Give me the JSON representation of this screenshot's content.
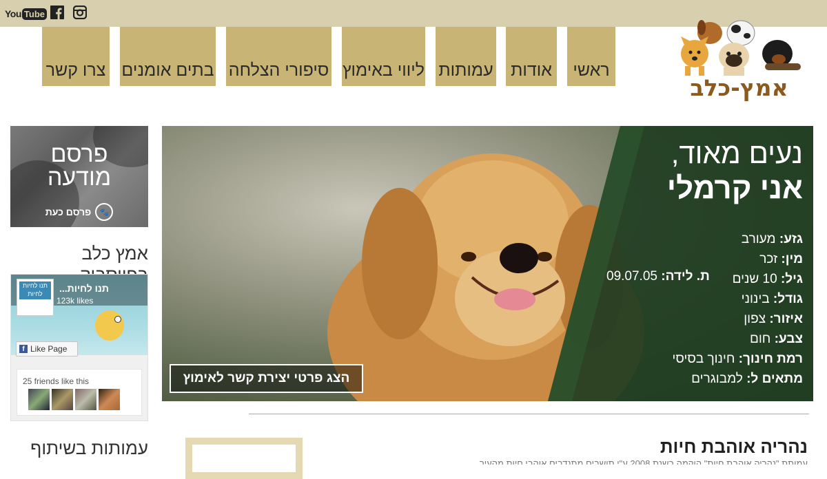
{
  "social": {
    "youtube_you": "You",
    "youtube_tube": "Tube",
    "facebook_glyph": "f",
    "icons": [
      "youtube-icon",
      "facebook-icon",
      "instagram-icon"
    ]
  },
  "nav": {
    "items": [
      {
        "label": "ראשי"
      },
      {
        "label": "אודות"
      },
      {
        "label": "עמותות"
      },
      {
        "label": "ליווי באימוץ"
      },
      {
        "label": "סיפורי הצלחה"
      },
      {
        "label": "בתים אומנים"
      },
      {
        "label": "צרו קשר"
      }
    ]
  },
  "logo": {
    "text": "אמץ-כלב"
  },
  "ad": {
    "title_line1": "פרסם",
    "title_line2": "מודעה",
    "cta": "פרסם כעת"
  },
  "sidebar": {
    "facebook_heading": "אמץ כלב בפייסבוק",
    "partners_heading": "עמותות בשיתוף"
  },
  "fb_widget": {
    "page_name": "תנו לחיות...",
    "likes": "123k likes",
    "like_button": "Like Page",
    "friends_text": "25 friends like this",
    "thumb_text_line1": "תנו לחיות",
    "thumb_text_line2": "לחיות"
  },
  "hero": {
    "line1": "נעים מאוד,",
    "line2": "אני קרמלי",
    "attributes": [
      {
        "label": "גזע:",
        "value": "מעורב"
      },
      {
        "label": "מין:",
        "value": "זכר"
      },
      {
        "label": "גיל:",
        "value": "10 שנים"
      },
      {
        "label": "גודל:",
        "value": "בינוני"
      },
      {
        "label": "איזור:",
        "value": "צפון"
      },
      {
        "label": "צבע:",
        "value": "חום"
      },
      {
        "label": "רמת חינוך:",
        "value": "חינוך בסיסי"
      },
      {
        "label": "מתאים ל:",
        "value": "למבוגרים"
      }
    ],
    "birth_label": "ת. לידה:",
    "birth_value": "09.07.05",
    "cta_button": "הצג פרטי יצירת קשר לאימוץ"
  },
  "news": {
    "title": "נהריה אוהבת חיות",
    "snippet": "עמותת \"נהריה אוהבת חיות\" הוקמה בשנת 2008 ע\"י תושבים מתנדבים אוהבי חיות מהעיר"
  },
  "colors": {
    "topbar": "#d8cfae",
    "nav": "#c8b576",
    "logo_text": "#8b5a1c",
    "divider": "#b8b05c",
    "hero_panel": "#1f3d22"
  }
}
